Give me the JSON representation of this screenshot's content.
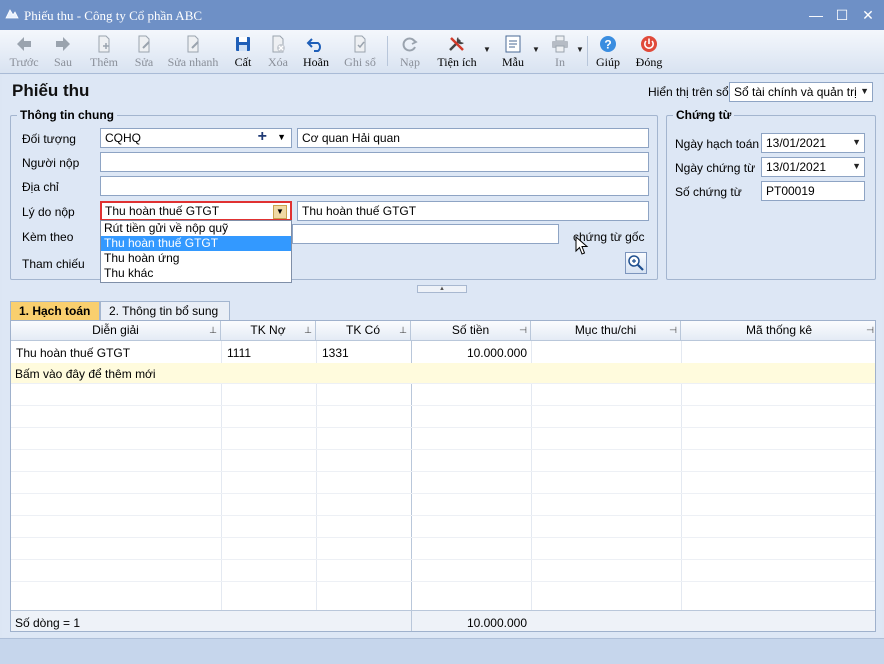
{
  "window": {
    "title": "Phiếu thu - Công ty Cổ phần ABC",
    "minimize": "—",
    "maximize": "☐",
    "close": "✕"
  },
  "toolbar": {
    "prev": "Trước",
    "next": "Sau",
    "add": "Thêm",
    "edit": "Sửa",
    "quick_edit": "Sửa nhanh",
    "save": "Cất",
    "delete": "Xóa",
    "undo": "Hoãn",
    "post": "Ghi sổ",
    "reload": "Nạp",
    "utilities": "Tiện ích",
    "template": "Mẫu",
    "print": "In",
    "help": "Giúp",
    "close": "Đóng"
  },
  "form": {
    "heading": "Phiếu thu",
    "display_label": "Hiển thị trên sổ",
    "display_value": "Sổ tài chính và quản trị"
  },
  "general": {
    "title": "Thông tin chung",
    "object_label": "Đối tượng",
    "object_code": "CQHQ",
    "object_name": "Cơ quan Hải quan",
    "payer_label": "Người nộp",
    "payer_value": "",
    "address_label": "Địa chỉ",
    "address_value": "",
    "reason_label": "Lý do nộp",
    "reason_value": "Thu hoàn thuế GTGT",
    "reason_text": "Thu hoàn thuế GTGT",
    "attach_label": "Kèm theo",
    "attach_suffix": "chứng từ gốc",
    "reference_label": "Tham chiếu",
    "reason_options": [
      "Rút tiền gửi về nộp quỹ",
      "Thu hoàn thuế GTGT",
      "Thu hoàn ứng",
      "Thu khác"
    ],
    "selected_option_index": 1
  },
  "voucher": {
    "title": "Chứng từ",
    "posting_date_label": "Ngày hạch toán",
    "posting_date": "13/01/2021",
    "voucher_date_label": "Ngày chứng từ",
    "voucher_date": "13/01/2021",
    "voucher_no_label": "Số chứng từ",
    "voucher_no": "PT00019"
  },
  "tabs": {
    "accounting": "1. Hạch toán",
    "additional": "2. Thông tin bổ sung"
  },
  "grid": {
    "columns": [
      "Diễn giải",
      "TK Nợ",
      "TK Có",
      "Số tiền",
      "Mục thu/chi",
      "Mã thống kê"
    ],
    "rows": [
      {
        "desc": "Thu hoàn thuế GTGT",
        "debit": "1111",
        "credit": "1331",
        "amount": "10.000.000",
        "category": "",
        "stat": ""
      }
    ],
    "new_row_hint": "Bấm vào đây để thêm mới",
    "footer_count": "Số dòng = 1",
    "footer_total": "10.000.000"
  },
  "colors": {
    "titlebar": "#6e90c6",
    "highlight": "#3399ff",
    "tab_active": "#f9cf6e",
    "new_row": "#fffbdd",
    "focus_border": "#e03131"
  }
}
